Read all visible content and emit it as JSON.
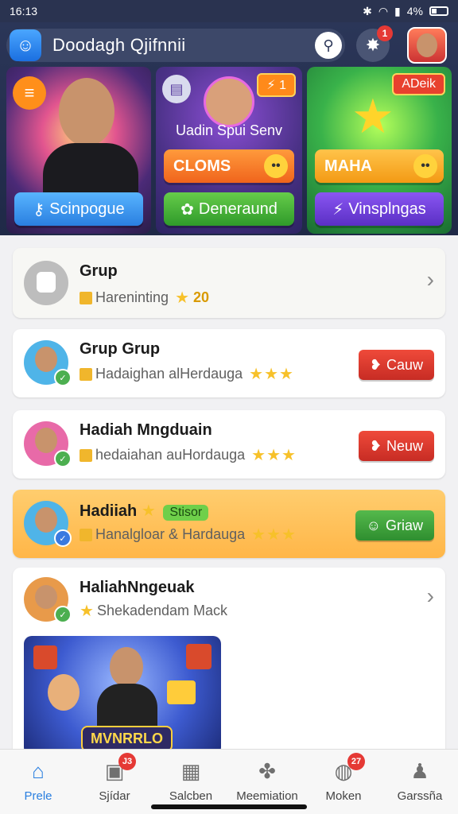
{
  "status": {
    "time": "16:13",
    "battery": "4%"
  },
  "header": {
    "search_text": "Doodagh Qjifnnii",
    "notification_count": "1",
    "cards": [
      {
        "button": "Scinpogue"
      },
      {
        "tag": "1",
        "name": "Uadin Spui Senv",
        "action": "CLOMS",
        "button": "Deneraund"
      },
      {
        "tag": "ADeik",
        "action": "MAHA",
        "button": "Vinsplngas"
      }
    ]
  },
  "list": [
    {
      "title": "Grup",
      "sub": "Hareninting",
      "score": "20"
    },
    {
      "title": "Grup Grup",
      "sub": "Hadaighan alHerdauga",
      "stars": "★★★",
      "action": "Cauw"
    },
    {
      "title": "Hadiah Mngduain",
      "sub": "hedaiahan auHordauga",
      "stars": "★★★",
      "action": "Neuw"
    },
    {
      "title": "Hadiiah",
      "pill": "Stisor",
      "sub": "Hanalgloar & Hardauga",
      "stars": "★★★",
      "action": "Griaw"
    },
    {
      "title": "HaliahNngeuak",
      "sub": "Shekadendam Mack",
      "promo": "MVNRRLO"
    }
  ],
  "nav": [
    {
      "label": "Prele"
    },
    {
      "label": "Sjídar",
      "badge": "J3"
    },
    {
      "label": "Salcben"
    },
    {
      "label": "Meemiation"
    },
    {
      "label": "Moken",
      "badge": "27"
    },
    {
      "label": "Garssña"
    }
  ]
}
